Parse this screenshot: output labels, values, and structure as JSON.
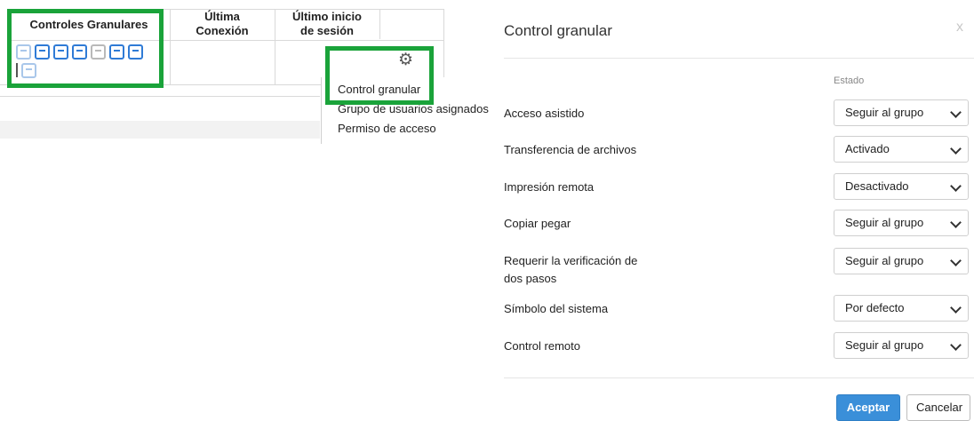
{
  "table": {
    "headers": {
      "granular": "Controles Granulares",
      "last_conn_line1": "Última",
      "last_conn_line2": "Conexión",
      "last_login_line1": "Último inicio",
      "last_login_line2": "de sesión"
    },
    "icons": [
      "assisted-access-icon",
      "file-transfer-icon",
      "print-icon",
      "copy-paste-icon",
      "two-step-icon",
      "system-tray-icon",
      "remote-control-icon",
      "policy-icon"
    ],
    "gear_glyph": "⚙"
  },
  "context_menu": {
    "items": [
      "Control granular",
      "Grupo de usuarios asignados",
      "Permiso de acceso"
    ]
  },
  "dialog": {
    "title": "Control granular",
    "close": "x",
    "column_header": "Estado",
    "rows": [
      {
        "label": "Acceso asistido",
        "value": "Seguir al grupo"
      },
      {
        "label": "Transferencia de archivos",
        "value": "Activado"
      },
      {
        "label": "Impresión remota",
        "value": "Desactivado"
      },
      {
        "label": "Copiar pegar",
        "value": "Seguir al grupo"
      },
      {
        "label_line1": "Requerir la verificación de",
        "label_line2": "dos pasos",
        "value": "Seguir al grupo"
      },
      {
        "label": "Símbolo del sistema",
        "value": "Por defecto"
      },
      {
        "label": "Control remoto",
        "value": "Seguir al grupo"
      }
    ],
    "accept": "Aceptar",
    "cancel": "Cancelar"
  },
  "colors": {
    "highlight_green": "#1aa33a",
    "primary_blue": "#3a8fd9",
    "icon_blue": "#2f7bd6"
  }
}
